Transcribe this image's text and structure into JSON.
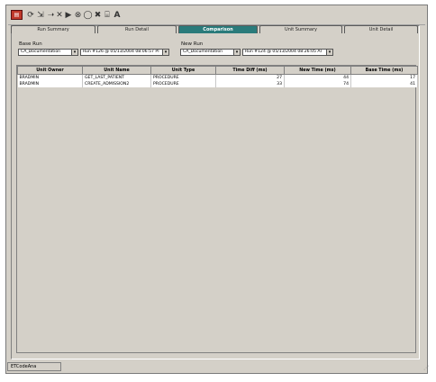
{
  "toolbar": {
    "icons": [
      "app-logo-icon",
      "sync-icon",
      "arrow-right-icon",
      "close-x-icon",
      "play-icon",
      "stop-icon",
      "pause-icon",
      "delete-icon",
      "refresh-icon",
      "font-icon"
    ]
  },
  "tabs": [
    "Run Summary",
    "Run Detail",
    "Comparison",
    "Unit Summary",
    "Unit Detail"
  ],
  "active_tab": 2,
  "base_run": {
    "label": "Base Run",
    "connection": "CA_Documentation",
    "run": "Run #126 @ 05/13/2004 08:06:57 PI"
  },
  "new_run": {
    "label": "New Run",
    "connection": "CA_Documentation",
    "run": "Run #124 @ 05/13/2004 08:26:05 AI"
  },
  "table": {
    "columns": [
      "Unit Owner",
      "Unit Name",
      "Unit Type",
      "Time Diff (ms)",
      "New Time (ms)",
      "Base Time (ms)"
    ],
    "rows": [
      [
        "BRADMIN",
        "GET_LAST_PATIENT",
        "PROCEDURE",
        "27",
        "44",
        "17"
      ],
      [
        "BRADMIN",
        "CREATE_ADMISSION2",
        "PROCEDURE",
        "33",
        "74",
        "41"
      ]
    ]
  },
  "status_tab": "ETCodeAna"
}
